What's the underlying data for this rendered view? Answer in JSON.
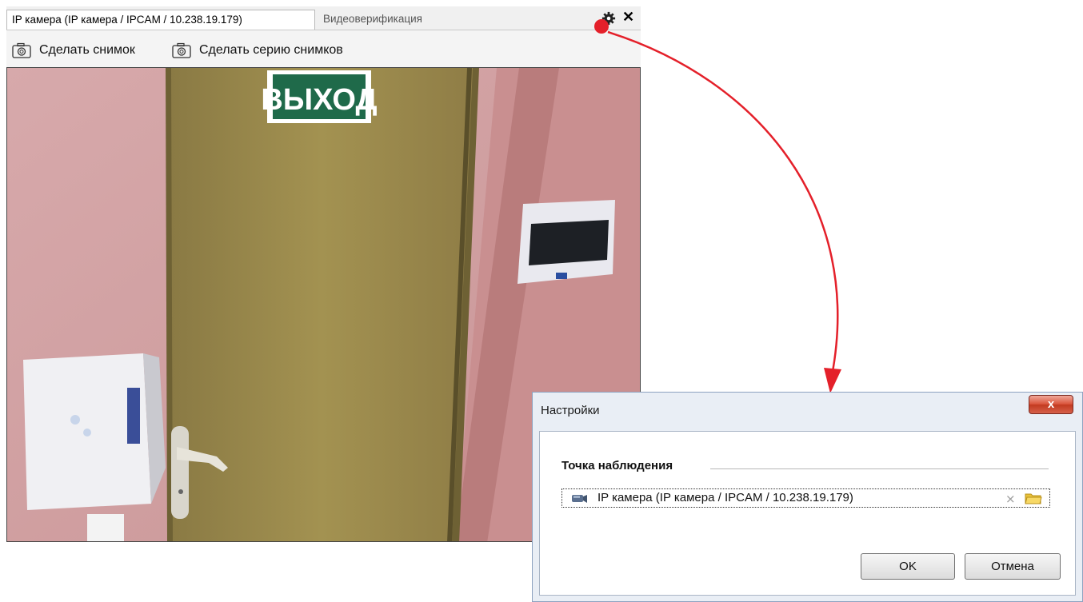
{
  "camera_panel": {
    "tabs": [
      {
        "label": "IP камера (IP камера / IPCAM / 10.238.19.179)",
        "active": true
      },
      {
        "label": "Видеоверификация",
        "active": false
      }
    ],
    "close_symbol": "✕",
    "toolbar": {
      "snapshot_label": "Сделать снимок",
      "series_label": "Сделать серию снимков"
    },
    "video_sign_text": "ВЫХОД"
  },
  "dialog": {
    "title": "Настройки",
    "close_symbol": "x",
    "group_label": "Точка наблюдения",
    "field_value": "IP камера (IP камера / IPCAM / 10.238.19.179)",
    "clear_symbol": "⨯",
    "ok_label": "OK",
    "cancel_label": "Отмена"
  },
  "colors": {
    "callout_arrow": "#e4202a",
    "dialog_close": "#c23a20",
    "sign_green": "#1f6a4a"
  },
  "icons": [
    "camera-icon",
    "gear-icon",
    "close-icon",
    "ip-camera-icon",
    "clear-icon",
    "folder-icon"
  ]
}
